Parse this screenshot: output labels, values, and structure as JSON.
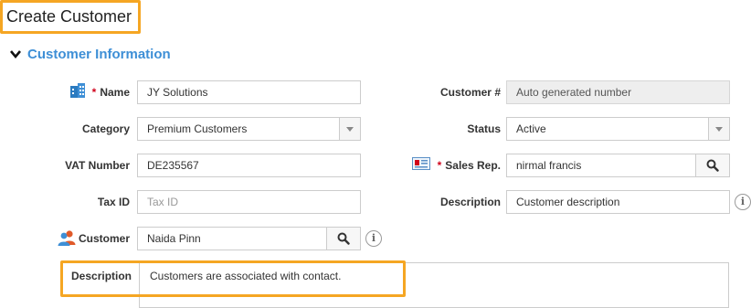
{
  "page": {
    "title": "Create Customer"
  },
  "section": {
    "title": "Customer Information"
  },
  "left": {
    "name": {
      "label": "Name",
      "required_mark": "*",
      "value": "JY Solutions"
    },
    "category": {
      "label": "Category",
      "value": "Premium Customers"
    },
    "vat": {
      "label": "VAT Number",
      "value": "DE235567"
    },
    "tax_id": {
      "label": "Tax ID",
      "placeholder": "Tax ID"
    },
    "customer": {
      "label": "Customer",
      "value": "Naida Pinn"
    },
    "description": {
      "label": "Description",
      "value": "Customers are associated with contact."
    }
  },
  "right": {
    "customer_number": {
      "label": "Customer #",
      "value": "Auto generated number"
    },
    "status": {
      "label": "Status",
      "value": "Active"
    },
    "sales_rep": {
      "label": "Sales Rep.",
      "required_mark": "*",
      "value": "nirmal francis"
    },
    "description": {
      "label": "Description",
      "value": "Customer description"
    }
  },
  "icons": {
    "name": "building-icon",
    "sales_rep": "id-card-icon",
    "customer": "users-icon",
    "search": "search-icon",
    "info": "info-icon",
    "section_toggle": "chevron-down-icon",
    "select": "dropdown-arrow-icon"
  },
  "colors": {
    "highlight": "#f5a623",
    "section_title": "#3e8fd6",
    "required": "#d0021b"
  }
}
